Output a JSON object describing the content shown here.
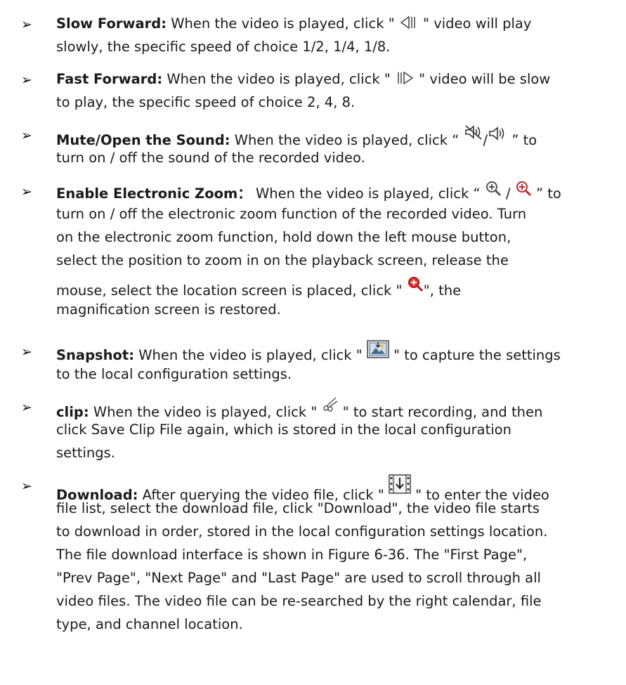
{
  "items": [
    {
      "heading": "Slow Forward:",
      "icon": "slow-forward-icon",
      "text_a": " When the video is played, click \" ",
      "text_b": " \" video will play",
      "line2": "slowly, the specific speed of choice 1/2, 1/4, 1/8."
    },
    {
      "heading": "Fast Forward:",
      "icon": "fast-forward-icon",
      "text_a": " When the video is played, click \" ",
      "text_b": " \" video will be slow",
      "line2": "to play, the specific speed of choice 2, 4, 8."
    },
    {
      "heading": "Mute/Open the Sound:",
      "icons": [
        "mute-icon",
        "speaker-icon"
      ],
      "text_a": " When the video is played, click “ ",
      "sep": "/",
      "text_b": " ” to",
      "line2": "turn on / off the sound of the recorded video."
    },
    {
      "heading": "Enable Electronic Zoom：",
      "icons": [
        "zoom-in-icon",
        "zoom-in-active-icon",
        "zoom-restore-icon"
      ],
      "text_a": " When the video is played, click “ ",
      "sep": " / ",
      "text_b": " ” to",
      "line2": "turn on / off the electronic zoom function of the recorded video. Turn",
      "line3": "on the electronic zoom function, hold down the left mouse button,",
      "line4": "select the position to zoom in on the playback screen, release the",
      "line5_a": "mouse, select the location screen is placed, click \" ",
      "line5_b": "\", the",
      "line6": "magnification screen is restored."
    },
    {
      "heading": "Snapshot:",
      "icon": "snapshot-icon",
      "text_a": " When the video is played, click \" ",
      "text_b": " \" to capture the settings",
      "line2": "to the local configuration settings."
    },
    {
      "heading": "clip:",
      "icon": "scissors-icon",
      "text_a": " When the video is played, click \"   ",
      "text_b": "   \" to start recording, and then",
      "line2": "click Save Clip File again, which is stored in the local configuration",
      "line3": "settings."
    },
    {
      "heading": "Download:",
      "icon": "download-icon",
      "text_a": " After querying the video file, click \" ",
      "text_b": " \" to enter the video",
      "line2": "file list, select the download file, click \"Download\", the video file starts",
      "line3": "to download in order, stored in the local configuration settings location.",
      "line4": "The file download interface is shown in Figure 6-36. The \"First Page\",",
      "line5": "\"Prev Page\", \"Next Page\" and \"Last Page\" are used to scroll through all",
      "line6": "video files. The video file can be re-searched by the right calendar, file",
      "line7": "type, and channel location."
    }
  ]
}
